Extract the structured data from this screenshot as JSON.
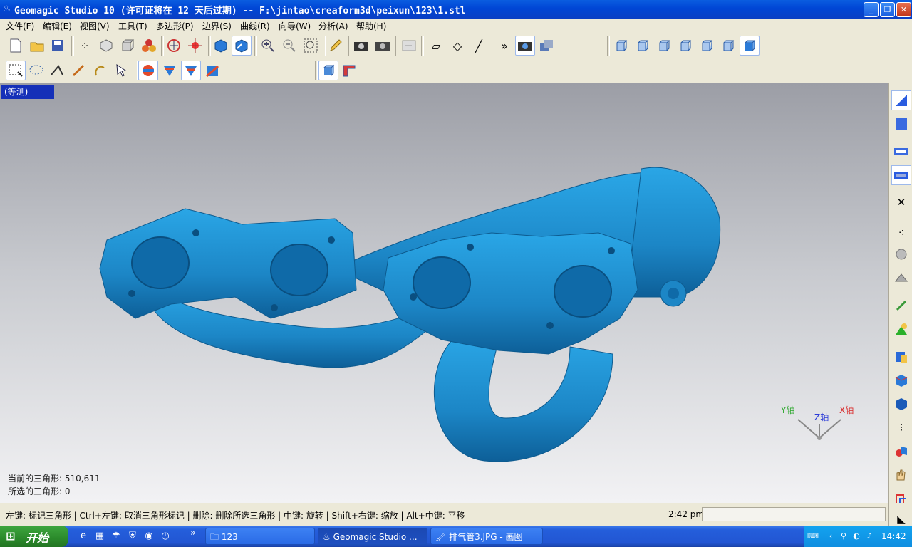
{
  "window": {
    "title": "Geomagic Studio 10 (许可证将在 12 天后过期) -- F:\\jintao\\creaform3d\\peixun\\123\\1.stl",
    "minimize_label": "_",
    "maximize_label": "❐",
    "close_label": "✕"
  },
  "menu": [
    "文件(F)",
    "编辑(E)",
    "视图(V)",
    "工具(T)",
    "多边形(P)",
    "边界(S)",
    "曲线(R)",
    "向导(W)",
    "分析(A)",
    "帮助(H)"
  ],
  "toolbar": {
    "overflow_label": "»"
  },
  "viewport": {
    "view_label": "(等测)",
    "model_color": "#1c86c6",
    "stats": {
      "current_triangles": "当前的三角形: 510,611",
      "selected_triangles": "所选的三角形: 0"
    },
    "axes": {
      "y": "Y轴",
      "z": "Z轴",
      "x": "X轴"
    }
  },
  "statusbar": {
    "hint": "左键: 标记三角形 | Ctrl+左键: 取消三角形标记 | 删除: 删除所选三角形 | 中键: 旋转 | Shift+右键: 缩放 | Alt+中键: 平移",
    "time": "2:42 pm"
  },
  "taskbar": {
    "start_label": "开始",
    "tasks": [
      {
        "label": "123",
        "icon": "folder-icon"
      },
      {
        "label": "Geomagic Studio ...",
        "icon": "geomagic-icon"
      },
      {
        "label": "排气管3.JPG - 画图",
        "icon": "paint-icon"
      }
    ],
    "clock": "14:42"
  },
  "colors": {
    "titlebar": "#0a5de0",
    "view_label_bg": "#1530b8",
    "model": "#1c86c6",
    "taskbar": "#245edb",
    "start": "#3ea63e"
  }
}
